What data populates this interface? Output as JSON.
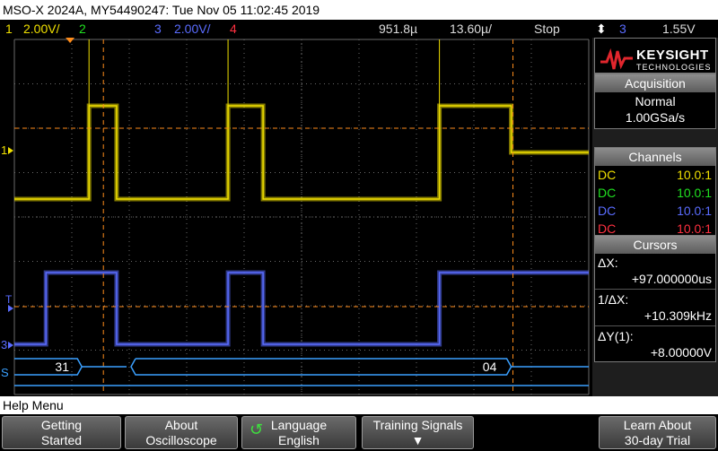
{
  "title": "MSO-X 2024A, MY54490247: Tue Nov 05 11:02:45 2019",
  "status": {
    "ch1_num": "1",
    "ch1_scale": "2.00V/",
    "ch2_num": "2",
    "ch3_num": "3",
    "ch3_scale": "2.00V/",
    "ch4_num": "4",
    "time_position": "951.8µ",
    "time_scale": "13.60µ/",
    "run_state": "Stop",
    "trigger_source": "3",
    "trigger_level": "1.55V"
  },
  "brand": {
    "name": "KEYSIGHT",
    "sub": "TECHNOLOGIES"
  },
  "acquisition": {
    "header": "Acquisition",
    "mode": "Normal",
    "rate": "1.00GSa/s"
  },
  "channels": {
    "header": "Channels",
    "rows": [
      {
        "coupling": "DC",
        "probe": "10.0:1",
        "color": "#f0e000"
      },
      {
        "coupling": "DC",
        "probe": "10.0:1",
        "color": "#20e020"
      },
      {
        "coupling": "DC",
        "probe": "10.0:1",
        "color": "#5a6cff"
      },
      {
        "coupling": "DC",
        "probe": "10.0:1",
        "color": "#ff3040"
      }
    ]
  },
  "cursors": {
    "header": "Cursors",
    "dx_label": "ΔX:",
    "dx_value": "+97.000000us",
    "inv_dx_label": "1/ΔX:",
    "inv_dx_value": "+10.309kHz",
    "dy_label": "ΔY(1):",
    "dy_value": "+8.00000V"
  },
  "markers": {
    "ch1": "1",
    "ch3": "3",
    "trigger": "T",
    "serial": "S"
  },
  "bus": {
    "value_left": "31",
    "value_right": "04"
  },
  "help": "Help Menu",
  "softkeys": [
    {
      "line1": "Getting",
      "line2": "Started"
    },
    {
      "line1": "About",
      "line2": "Oscilloscope"
    },
    {
      "line1": "Language",
      "line2": "English"
    },
    {
      "line1": "Training Signals",
      "line2": ""
    },
    {
      "line1": "Learn About",
      "line2": "30-day Trial"
    }
  ],
  "colors": {
    "ch1": "#f0e000",
    "ch2": "#20e020",
    "ch3": "#5a6cff",
    "ch4": "#ff3040",
    "cursor": "#ff8c1a",
    "bus": "#3aa0ff",
    "grid": "#6a6a6a"
  },
  "waveforms": {
    "ch1_transitions": [
      {
        "t": 0.0,
        "level": "low"
      },
      {
        "t": 0.13,
        "level": "high"
      },
      {
        "t": 0.178,
        "level": "low"
      },
      {
        "t": 0.372,
        "level": "high"
      },
      {
        "t": 0.433,
        "level": "low"
      },
      {
        "t": 0.74,
        "level": "high"
      },
      {
        "t": 0.865,
        "level": "mid"
      }
    ],
    "ch3_transitions": [
      {
        "t": 0.0,
        "level": "low"
      },
      {
        "t": 0.055,
        "level": "high"
      },
      {
        "t": 0.178,
        "level": "low"
      },
      {
        "t": 0.372,
        "level": "high"
      },
      {
        "t": 0.433,
        "level": "low"
      },
      {
        "t": 0.74,
        "level": "high"
      }
    ]
  }
}
